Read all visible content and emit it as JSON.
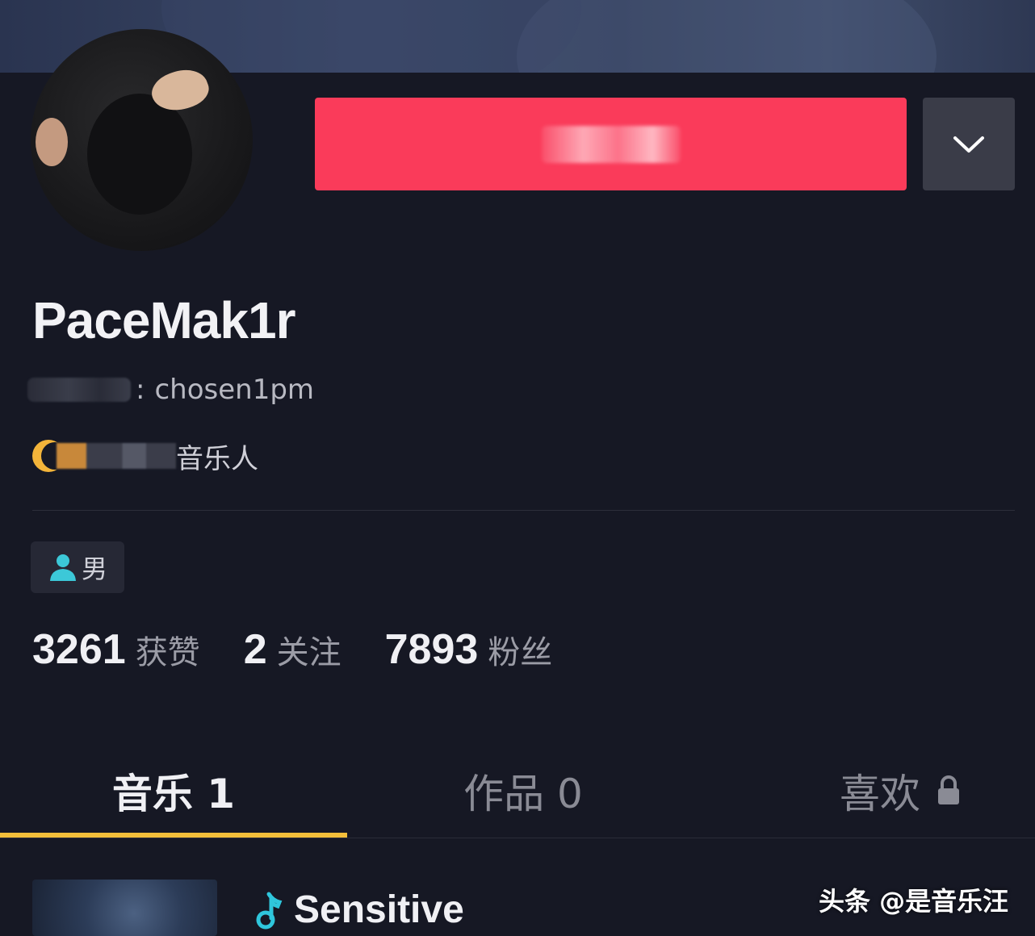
{
  "profile": {
    "username": "PaceMak1r",
    "uid_separator": ":",
    "uid_value": "chosen1pm",
    "tag_text": "音乐人",
    "gender": "男"
  },
  "actions": {
    "follow_label": "",
    "more_icon": "chevron-down-icon",
    "follow_color": "#fa3b5a"
  },
  "stats": [
    {
      "value": "3261",
      "label": "获赞"
    },
    {
      "value": "2",
      "label": "关注"
    },
    {
      "value": "7893",
      "label": "粉丝"
    }
  ],
  "tabs": [
    {
      "label": "音乐 1",
      "active": true
    },
    {
      "label": "作品 0",
      "active": false
    },
    {
      "label": "喜欢",
      "active": false,
      "icon": "lock-icon"
    }
  ],
  "tab_indicator_color": "#f3be3a",
  "list": [
    {
      "title": "Sensitive",
      "icon": "music-note-icon"
    }
  ],
  "watermark": "头条 @是音乐汪"
}
